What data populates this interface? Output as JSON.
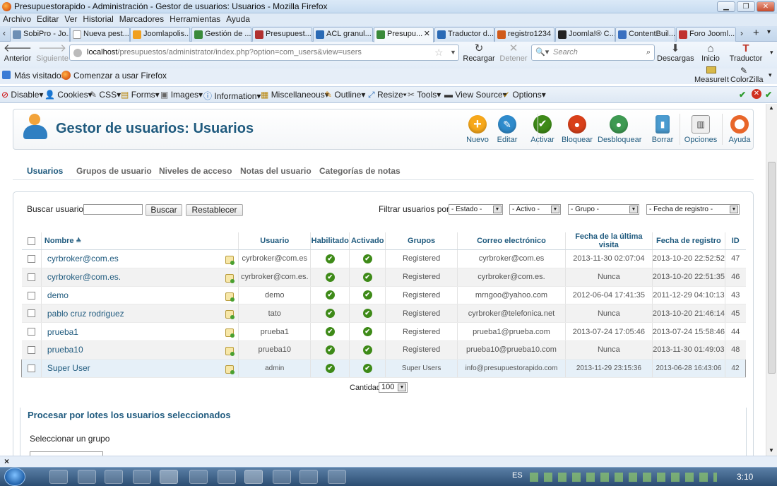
{
  "window": {
    "title": "Presupuestorapido - Administración - Gestor de usuarios: Usuarios - Mozilla Firefox"
  },
  "menu": [
    "Archivo",
    "Editar",
    "Ver",
    "Historial",
    "Marcadores",
    "Herramientas",
    "Ayuda"
  ],
  "tabs": [
    "SobiPro - Jo...",
    "Nueva pest...",
    "Joomlapolis...",
    "Gestión de ...",
    "Presupuest...",
    "ACL granul...",
    "Presupu...",
    "Traductor d...",
    "registro1234",
    "Joomla!® C...",
    "ContentBuil...",
    "Foro Jooml..."
  ],
  "nav": {
    "back": "Anterior",
    "forward": "Siguiente",
    "reload": "Recargar",
    "stop": "Detener",
    "downloads": "Descargas",
    "home": "Inicio",
    "translator": "Traductor"
  },
  "url": {
    "host": "localhost",
    "path": "/presupuestos/administrator/index.php?option=com_users&view=users"
  },
  "search": {
    "placeholder": "Search"
  },
  "bookmarks": [
    "Más visitados",
    "Comenzar a usar Firefox"
  ],
  "bookmarks_right": [
    "MeasureIt",
    "ColorZilla"
  ],
  "devbar": [
    "Disable▾",
    "Cookies▾",
    "CSS▾",
    "Forms▾",
    "Images▾",
    "Information▾",
    "Miscellaneous▾",
    "Outline▾",
    "Resize▾",
    "Tools▾",
    "View Source▾",
    "Options▾"
  ],
  "page": {
    "title": "Gestor de usuarios: Usuarios"
  },
  "toolbar": [
    {
      "label": "Nuevo",
      "color": "#f7a81b"
    },
    {
      "label": "Editar",
      "color": "#2f8bcc"
    },
    {
      "label": "Activar",
      "color": "#3e8a18"
    },
    {
      "label": "Bloquear",
      "color": "#d9401a"
    },
    {
      "label": "Desbloquear",
      "color": "#3e9a52"
    },
    {
      "label": "Borrar",
      "color": "#4a9bd0"
    },
    {
      "label": "Opciones",
      "color": "#8a8a8a"
    },
    {
      "label": "Ayuda",
      "color": "#e8662a"
    }
  ],
  "subnav": [
    "Usuarios",
    "Grupos de usuario",
    "Niveles de acceso",
    "Notas del usuario",
    "Categorías de notas"
  ],
  "filters": {
    "search_label": "Buscar usuarios",
    "search_btn": "Buscar",
    "reset_btn": "Restablecer",
    "filter_label": "Filtrar usuarios por:",
    "estado": "- Estado -",
    "activo": "- Activo -",
    "grupo": "- Grupo -",
    "fecha": "- Fecha de registro -"
  },
  "columns": [
    "Nombre",
    "Usuario",
    "Habilitado",
    "Activado",
    "Grupos",
    "Correo electrónico",
    "Fecha de la última visita",
    "Fecha de registro",
    "ID"
  ],
  "users": [
    {
      "name": "cyrbroker@com.es",
      "username": "cyrbroker@com.es",
      "group": "Registered",
      "email": "cyrbroker@com.es",
      "last": "2013-11-30 02:07:04",
      "reg": "2013-10-20 22:52:52",
      "id": "47"
    },
    {
      "name": "cyrbroker@com.es.",
      "username": "cyrbroker@com.es.",
      "group": "Registered",
      "email": "cyrbroker@com.es.",
      "last": "Nunca",
      "reg": "2013-10-20 22:51:35",
      "id": "46"
    },
    {
      "name": "demo",
      "username": "demo",
      "group": "Registered",
      "email": "mrngoo@yahoo.com",
      "last": "2012-06-04 17:41:35",
      "reg": "2011-12-29 04:10:13",
      "id": "43"
    },
    {
      "name": "pablo cruz rodriguez",
      "username": "tato",
      "group": "Registered",
      "email": "cyrbroker@telefonica.net",
      "last": "Nunca",
      "reg": "2013-10-20 21:46:14",
      "id": "45"
    },
    {
      "name": "prueba1",
      "username": "prueba1",
      "group": "Registered",
      "email": "prueba1@prueba.com",
      "last": "2013-07-24 17:05:46",
      "reg": "2013-07-24 15:58:46",
      "id": "44"
    },
    {
      "name": "prueba10",
      "username": "prueba10",
      "group": "Registered",
      "email": "prueba10@prueba10.com",
      "last": "Nunca",
      "reg": "2013-11-30 01:49:03",
      "id": "48"
    },
    {
      "name": "Super User",
      "username": "admin",
      "group": "Super Users",
      "email": "info@presupuestorapido.com",
      "last": "2013-11-29 23:15:36",
      "reg": "2013-06-28 16:43:06",
      "id": "42"
    }
  ],
  "pagination": {
    "label": "Cantidad",
    "value": "100"
  },
  "batch": {
    "title": "Procesar por lotes los usuarios seleccionados",
    "group_label": "Seleccionar un grupo"
  },
  "taskbar": {
    "lang": "ES",
    "time": "3:10"
  }
}
